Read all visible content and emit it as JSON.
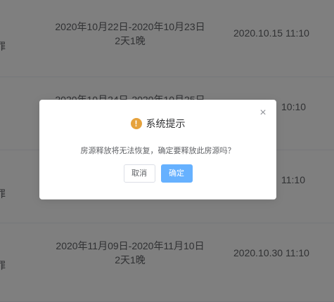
{
  "rows": [
    {
      "dates": "2020年10月22日-2020年10月23日",
      "nights": "2天1晚",
      "time": "2020.10.15 11:10",
      "cut": "罪"
    },
    {
      "dates": "2020年10月24日-2020年10月25日",
      "nights": "",
      "time": "10:10",
      "cut": ""
    },
    {
      "dates": "",
      "nights": "",
      "time": "11:10",
      "cut": "罪"
    },
    {
      "dates": "2020年11月09日-2020年11月10日",
      "nights": "2天1晚",
      "time": "2020.10.30 11:10",
      "cut": "罪"
    }
  ],
  "dialog": {
    "title": "系统提示",
    "icon": "warning-icon",
    "message": "房源释放将无法恢复，确定要释放此房源吗？",
    "cancel_label": "取消",
    "confirm_label": "确定",
    "close_symbol": "×"
  },
  "colors": {
    "overlay": "rgba(0,0,0,0.5)",
    "warning": "#e6a23c",
    "primary": "#66b1ff"
  }
}
